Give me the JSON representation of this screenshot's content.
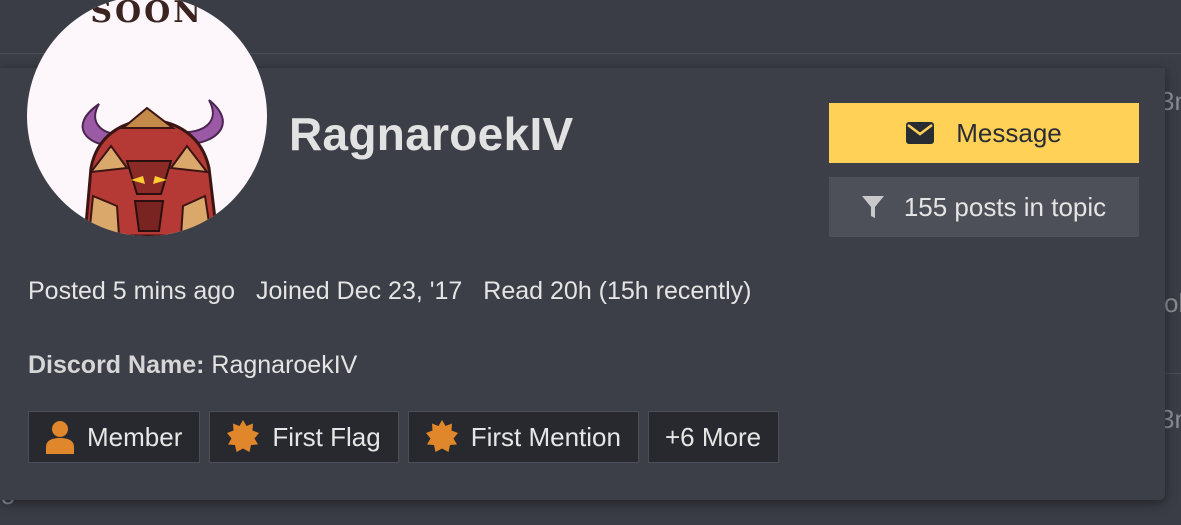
{
  "background": {
    "fragments": [
      "3n",
      "≡",
      "oly",
      "3n",
      "ʼo",
      "ro"
    ]
  },
  "user": {
    "username": "RagnaroekIV",
    "avatar_caption": "SOON"
  },
  "actions": {
    "message_label": "Message",
    "posts_in_topic_label": "155 posts in topic"
  },
  "meta": {
    "posted": "Posted 5 mins ago",
    "joined": "Joined Dec 23, '17",
    "read": "Read 20h (15h recently)"
  },
  "custom_fields": {
    "discord_label": "Discord Name:",
    "discord_value": "RagnaroekIV"
  },
  "badges": [
    {
      "label": "Member",
      "icon": "user-icon"
    },
    {
      "label": "First Flag",
      "icon": "badge-certificate-icon"
    },
    {
      "label": "First Mention",
      "icon": "badge-certificate-icon"
    },
    {
      "label": "+6 More",
      "icon": ""
    }
  ],
  "colors": {
    "accent": "#ffd257",
    "badge_icon": "#e0862b",
    "card_bg": "#3c3f48"
  }
}
